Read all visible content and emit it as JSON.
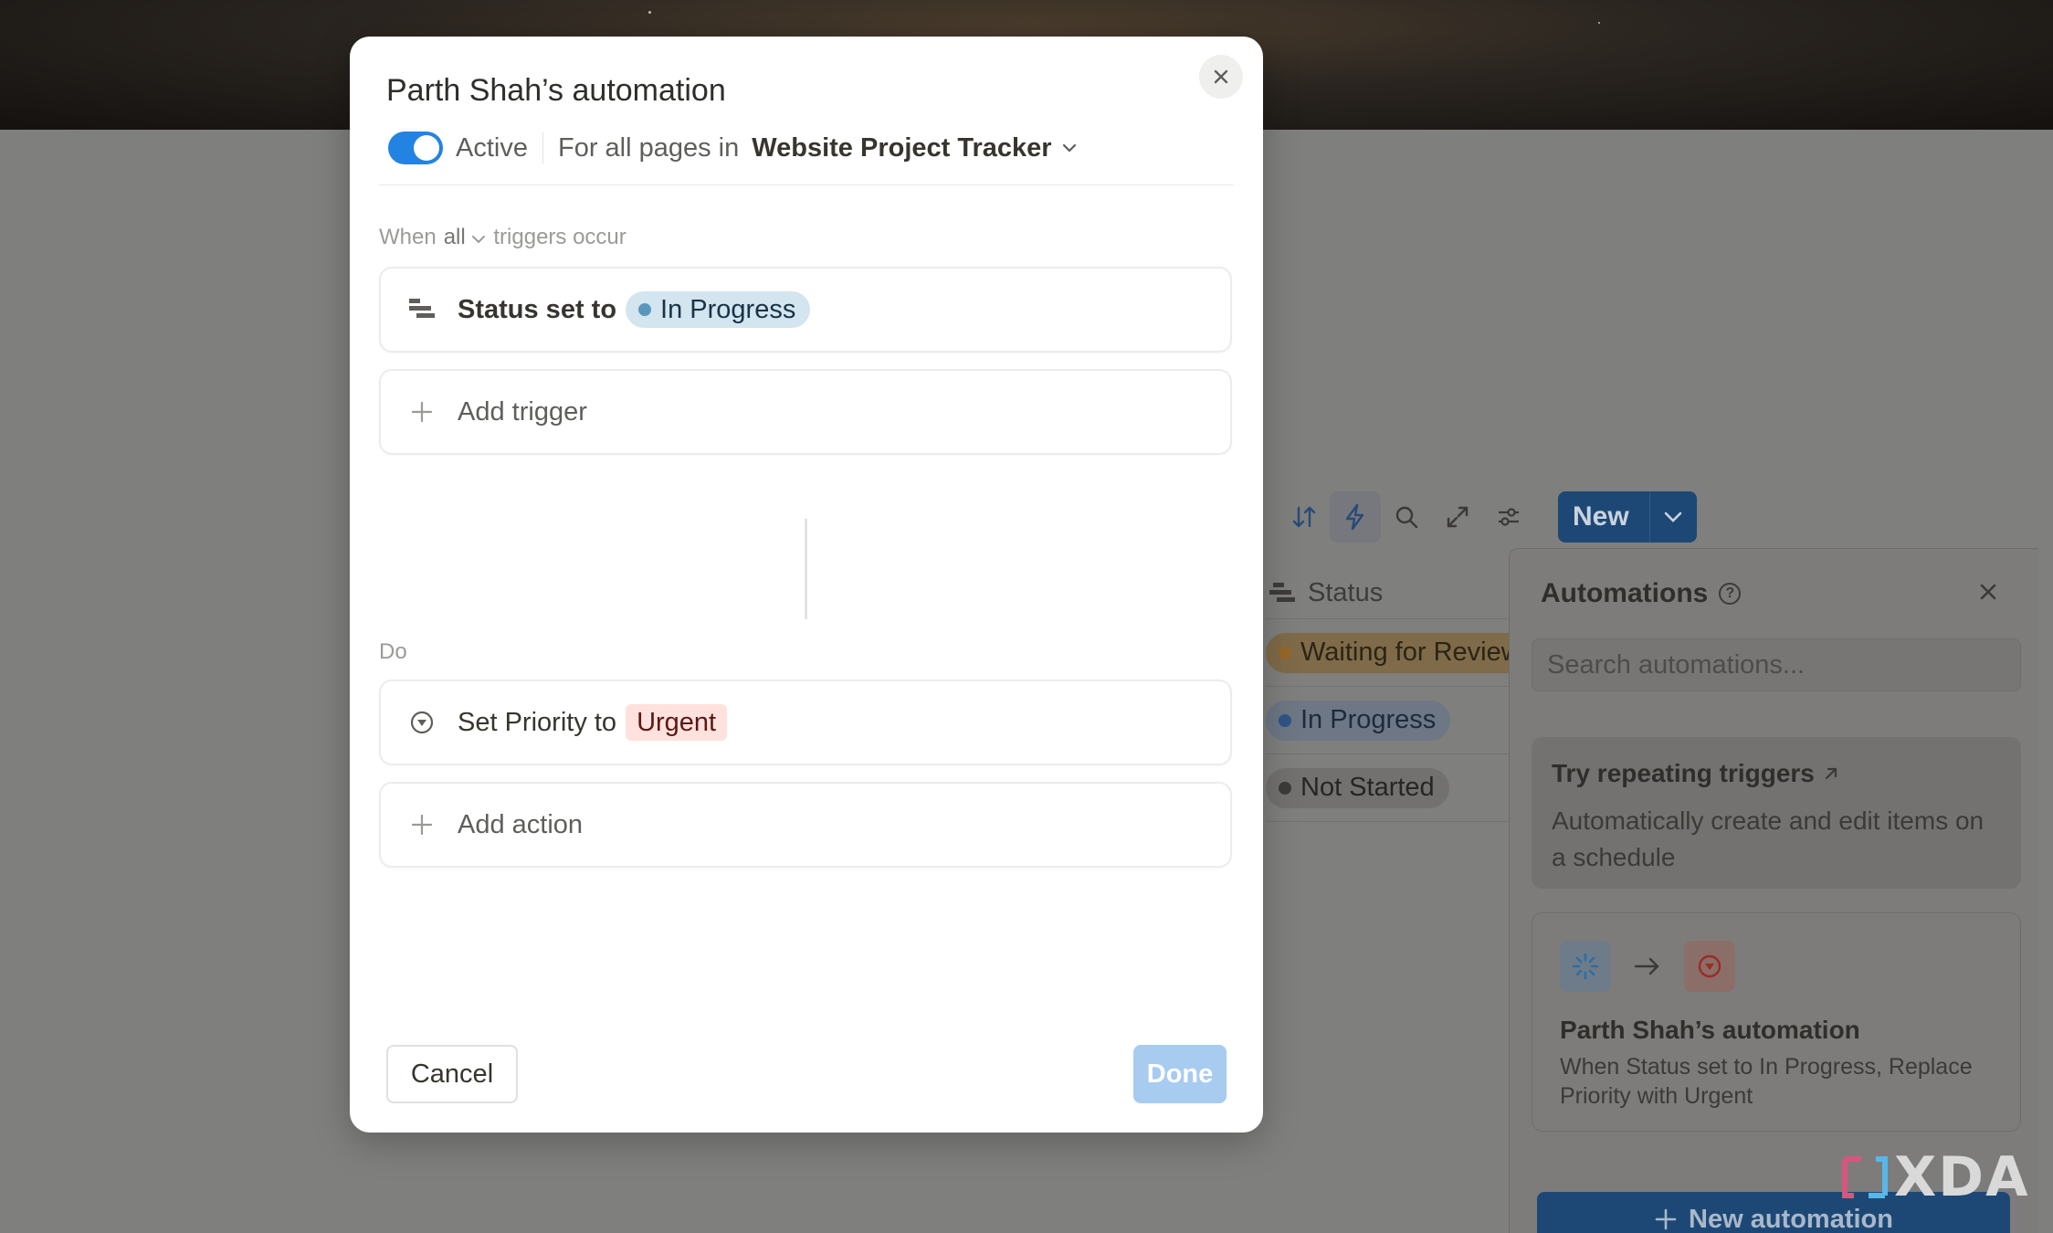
{
  "modal": {
    "title": "Parth Shah’s automation",
    "active_label": "Active",
    "scope_prefix": "For all pages in",
    "database_name": "Website Project Tracker",
    "when_prefix": "When",
    "when_mode": "all",
    "when_suffix": "triggers occur",
    "trigger": {
      "label": "Status set to",
      "value": "In Progress",
      "icon": "status-property-icon"
    },
    "add_trigger_label": "Add trigger",
    "do_label": "Do",
    "action": {
      "label": "Set Priority to",
      "value": "Urgent",
      "icon": "select-property-icon"
    },
    "add_action_label": "Add action",
    "cancel_label": "Cancel",
    "done_label": "Done",
    "toggle_on": true,
    "accent_color": "#2383e2"
  },
  "toolbar": {
    "new_label": "New"
  },
  "status_column": {
    "header": "Status",
    "rows": [
      "Waiting for Review",
      "In Progress",
      "Not Started"
    ]
  },
  "automations_panel": {
    "title": "Automations",
    "search_placeholder": "Search automations...",
    "promo_title": "Try repeating triggers",
    "promo_desc": "Automatically create and edit items on a schedule",
    "item_title": "Parth Shah’s automation",
    "item_desc": "When Status set to In Progress, Replace Priority with Urgent",
    "new_button_label": "New automation"
  },
  "watermark": "XDA"
}
